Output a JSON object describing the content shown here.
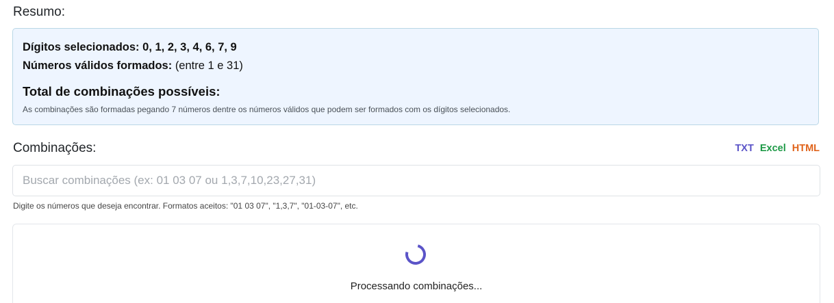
{
  "summary": {
    "title": "Resumo:",
    "digits_label": "Dígitos selecionados:",
    "digits_value": "0, 1, 2, 3, 4, 6, 7, 9",
    "valid_label": "Números válidos formados:",
    "valid_value": "(entre 1 e 31)",
    "total_label": "Total de combinações possíveis:",
    "note": "As combinações são formadas pegando 7 números dentre os números válidos que podem ser formados com os dígitos selecionados."
  },
  "combinations": {
    "title": "Combinações:",
    "export": {
      "txt": "TXT",
      "excel": "Excel",
      "html": "HTML"
    },
    "search": {
      "value": "",
      "placeholder": "Buscar combinações (ex: 01 03 07 ou 1,3,7,10,23,27,31)"
    },
    "help": "Digite os números que deseja encontrar. Formatos aceitos: \"01 03 07\", \"1,3,7\", \"01-03-07\", etc.",
    "status": "Processando combinações..."
  },
  "colors": {
    "accent": "#5b54c8",
    "excel": "#1e9a47",
    "html": "#e0641c",
    "summary_bg": "#eef5ff",
    "summary_border": "#b9d7e6"
  },
  "icons": {
    "loading": "loading-spinner-icon"
  }
}
